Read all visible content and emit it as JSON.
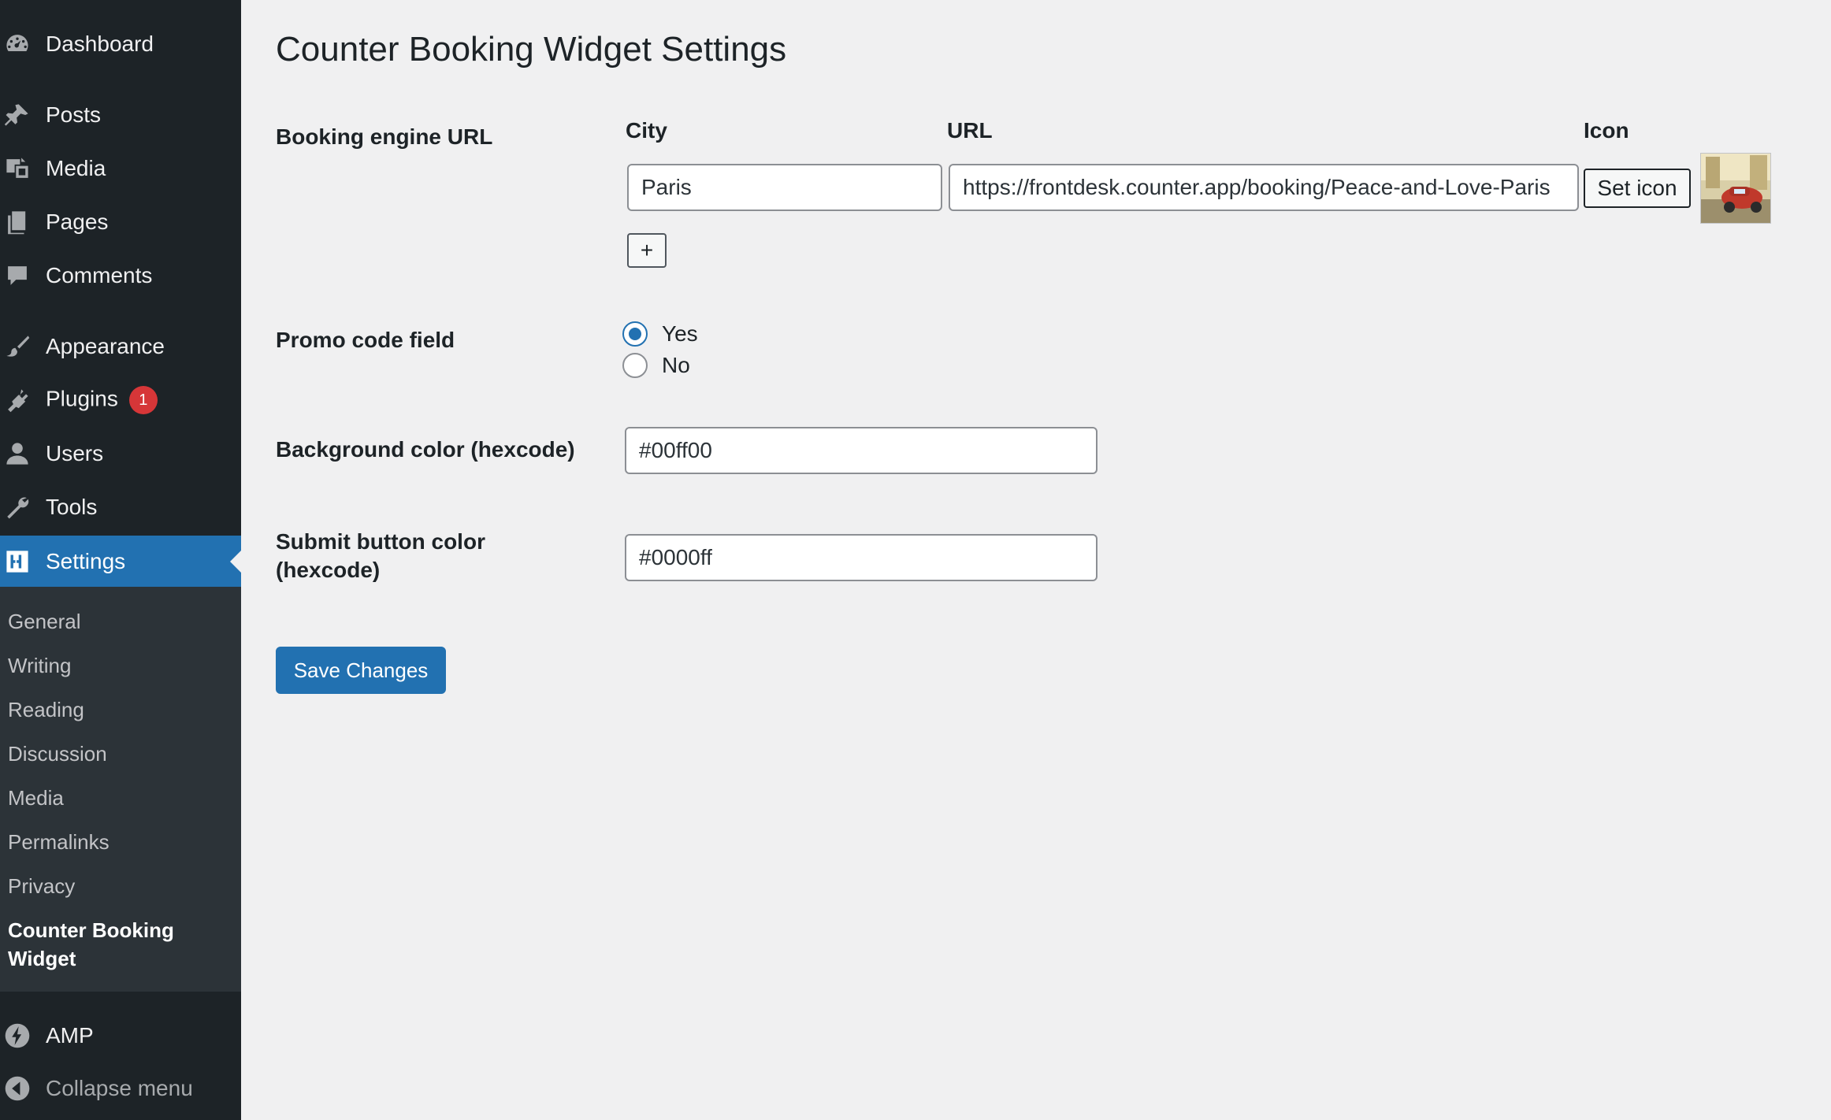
{
  "sidebar": {
    "items": [
      {
        "label": "Dashboard",
        "icon": "dashboard-icon"
      },
      {
        "label": "Posts",
        "icon": "pin-icon"
      },
      {
        "label": "Media",
        "icon": "media-icon"
      },
      {
        "label": "Pages",
        "icon": "pages-icon"
      },
      {
        "label": "Comments",
        "icon": "comments-icon"
      },
      {
        "label": "Appearance",
        "icon": "brush-icon"
      },
      {
        "label": "Plugins",
        "icon": "plug-icon",
        "badge": "1"
      },
      {
        "label": "Users",
        "icon": "user-icon"
      },
      {
        "label": "Tools",
        "icon": "wrench-icon"
      },
      {
        "label": "Settings",
        "icon": "settings-icon",
        "active": true
      }
    ],
    "submenu": [
      {
        "label": "General"
      },
      {
        "label": "Writing"
      },
      {
        "label": "Reading"
      },
      {
        "label": "Discussion"
      },
      {
        "label": "Media"
      },
      {
        "label": "Permalinks"
      },
      {
        "label": "Privacy"
      },
      {
        "label": "Counter Booking Widget",
        "current": true
      }
    ],
    "amp": {
      "label": "AMP",
      "icon": "amp-icon"
    },
    "collapse": {
      "label": "Collapse menu",
      "icon": "collapse-icon"
    }
  },
  "page": {
    "title": "Counter Booking Widget Settings"
  },
  "booking": {
    "label": "Booking engine URL",
    "col_city": "City",
    "col_url": "URL",
    "col_icon": "Icon",
    "city_value": "Paris",
    "url_value": "https://frontdesk.counter.app/booking/Peace-and-Love-Paris",
    "set_icon_label": "Set icon",
    "add_label": "+",
    "thumbnail": "red-car-street-thumbnail"
  },
  "promo": {
    "label": "Promo code field",
    "options": [
      {
        "label": "Yes",
        "checked": true
      },
      {
        "label": "No",
        "checked": false
      }
    ]
  },
  "bg_color": {
    "label": "Background color (hexcode)",
    "value": "#00ff00"
  },
  "submit_color": {
    "label_line1": "Submit button color",
    "label_line2": "(hexcode)",
    "value": "#0000ff"
  },
  "actions": {
    "save_label": "Save Changes"
  },
  "colors": {
    "sidebar_bg": "#1d2327",
    "submenu_bg": "#2c3338",
    "accent": "#2271b1",
    "badge": "#d63638",
    "page_bg": "#f0f0f1"
  }
}
